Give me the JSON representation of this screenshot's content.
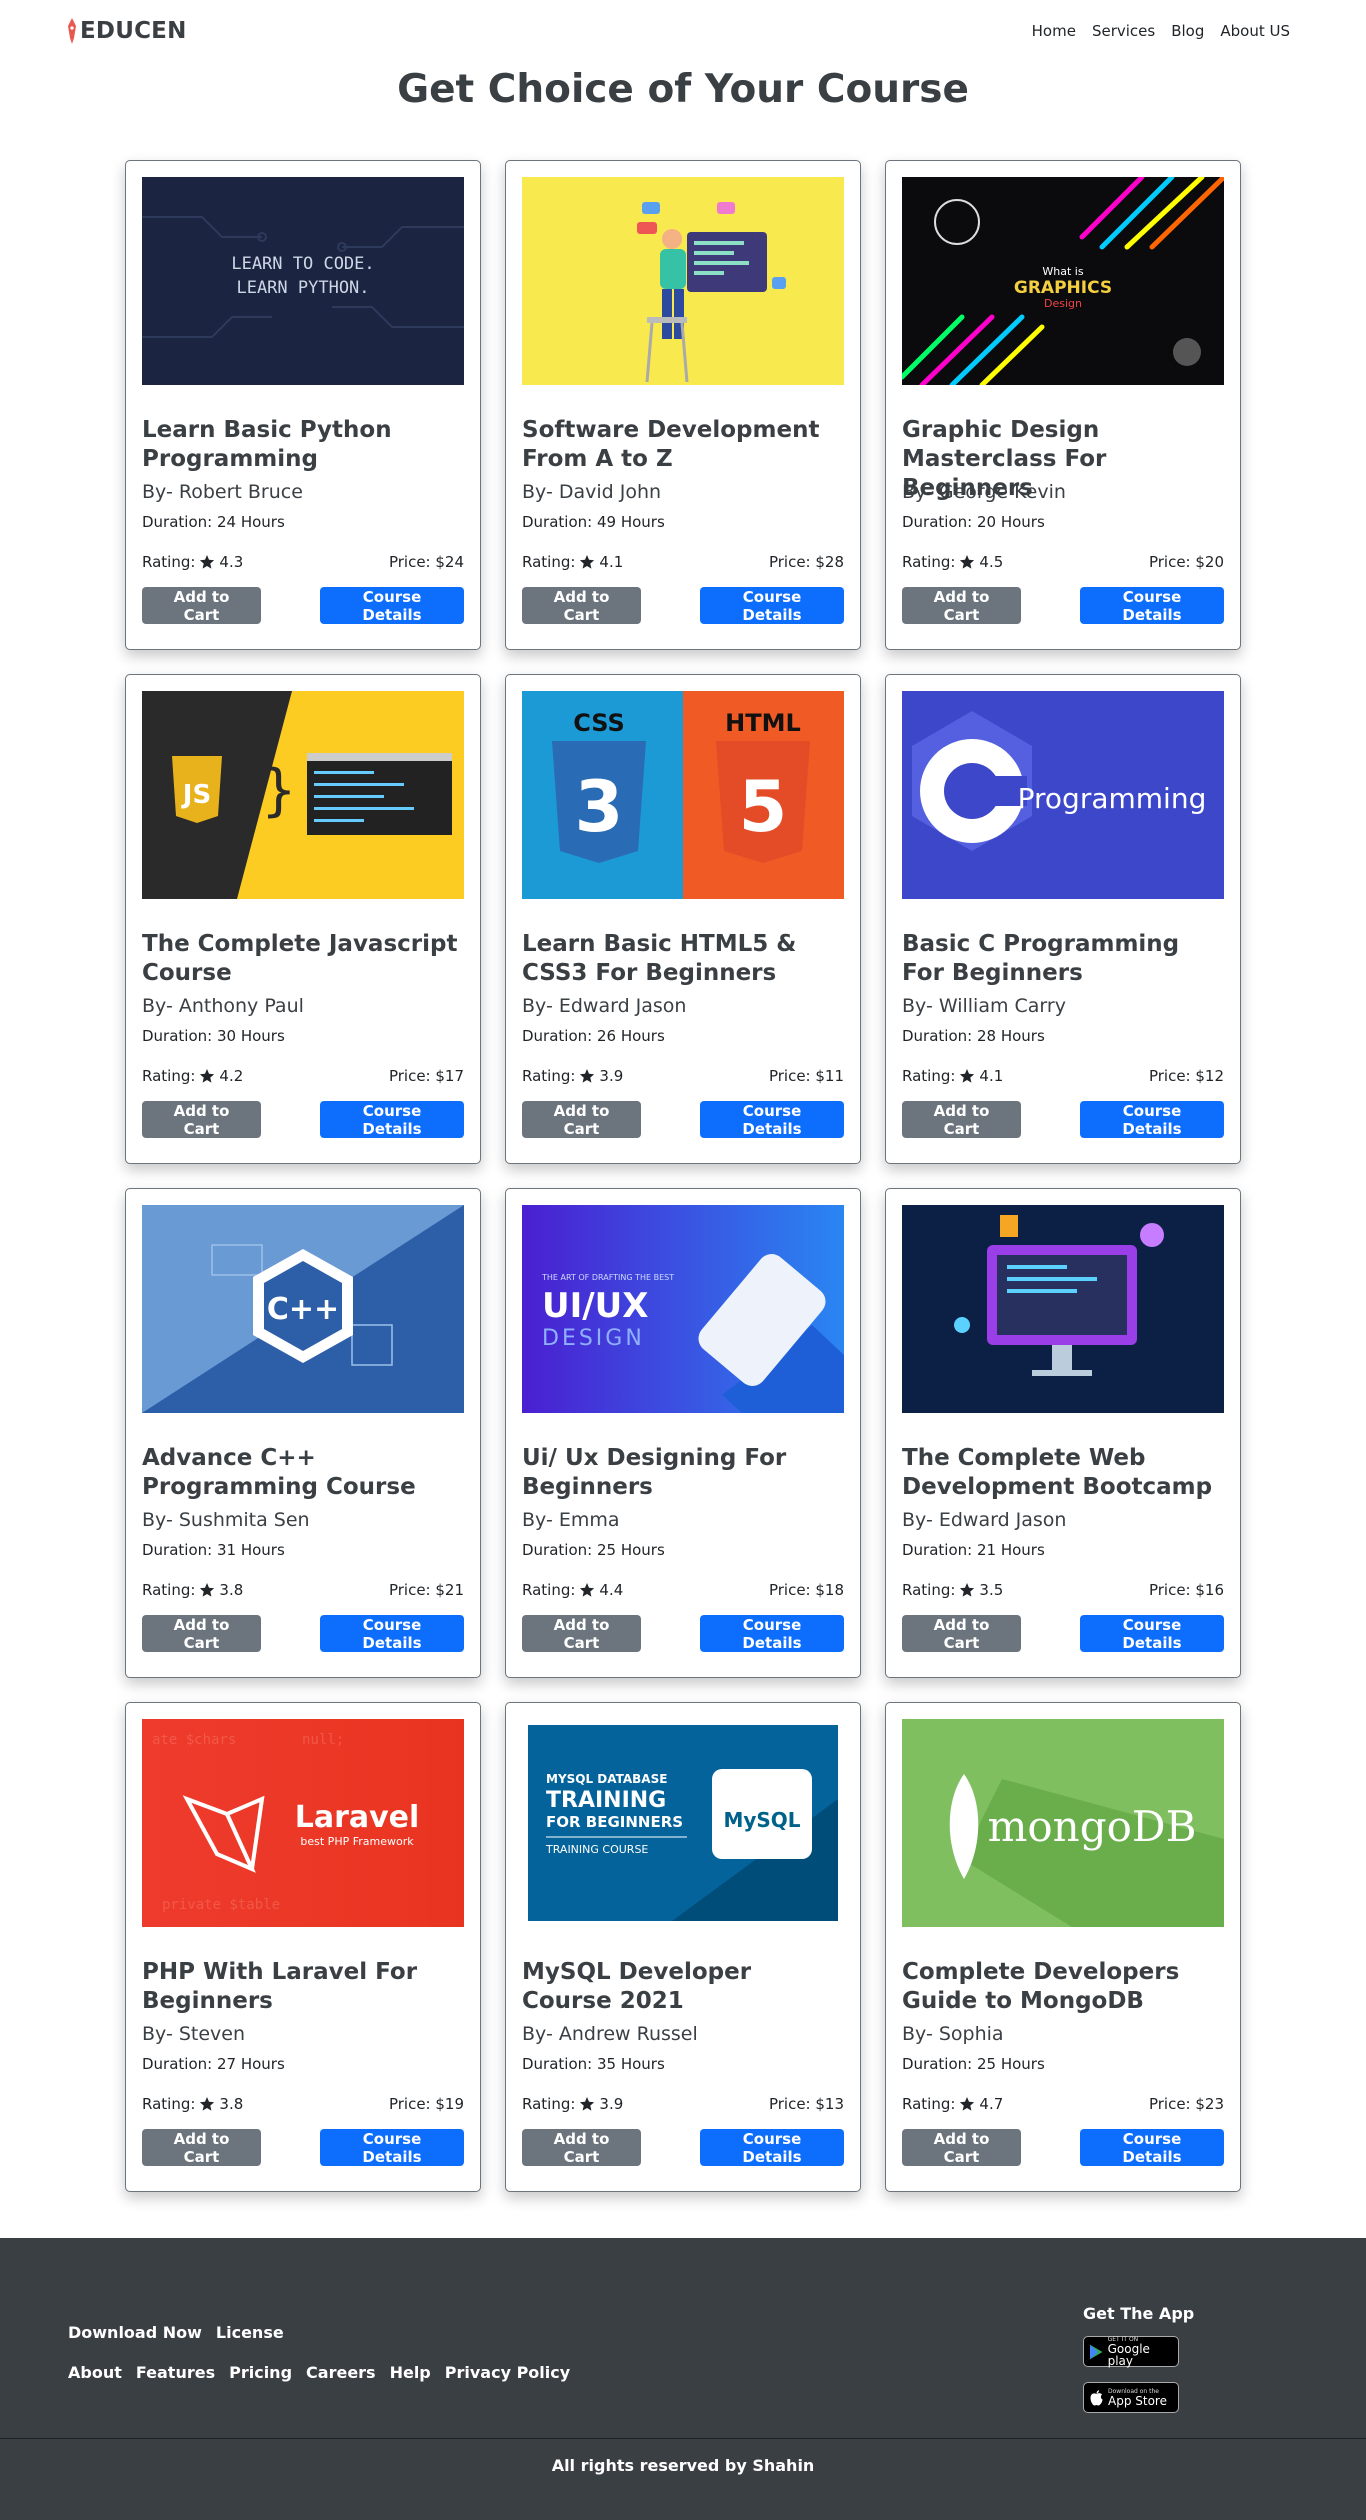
{
  "nav": {
    "brand": "EDUCEN",
    "links": [
      "Home",
      "Services",
      "Blog",
      "About US"
    ]
  },
  "page_title": "Get Choice of Your Course",
  "courses": [
    {
      "title": "Learn Basic Python Programming",
      "author": "By- Robert Bruce",
      "duration": "Duration: 24 Hours",
      "rating_label": "Rating:",
      "rating": "4.3",
      "price": "Price: $24",
      "thumb_text": "LEARN TO CODE. LEARN PYTHON."
    },
    {
      "title": "Software Development From A to Z",
      "author": "By- David John",
      "duration": "Duration: 49 Hours",
      "rating_label": "Rating:",
      "rating": "4.1",
      "price": "Price: $28",
      "thumb_text": ""
    },
    {
      "title": "Graphic Design Masterclass For Beginners",
      "author": "By- George Kevin",
      "duration": "Duration: 20 Hours",
      "rating_label": "Rating:",
      "rating": "4.5",
      "price": "Price: $20",
      "thumb_text": "What is GRAPHICS Design"
    },
    {
      "title": "The Complete Javascript Course",
      "author": "By- Anthony Paul",
      "duration": "Duration: 30 Hours",
      "rating_label": "Rating:",
      "rating": "4.2",
      "price": "Price: $17",
      "thumb_text": "JS"
    },
    {
      "title": "Learn Basic HTML5 & CSS3 For Beginners",
      "author": "By- Edward Jason",
      "duration": "Duration: 26 Hours",
      "rating_label": "Rating:",
      "rating": "3.9",
      "price": "Price: $11",
      "thumb_text": "CSS HTML"
    },
    {
      "title": "Basic C Programming For Beginners",
      "author": "By- William Carry",
      "duration": "Duration: 28 Hours",
      "rating_label": "Rating:",
      "rating": "4.1",
      "price": "Price: $12",
      "thumb_text": "Programming"
    },
    {
      "title": "Advance C++ Programming Course",
      "author": "By- Sushmita Sen",
      "duration": "Duration: 31 Hours",
      "rating_label": "Rating:",
      "rating": "3.8",
      "price": "Price: $21",
      "thumb_text": "C++"
    },
    {
      "title": "Ui/ Ux Designing For Beginners",
      "author": "By- Emma",
      "duration": "Duration: 25 Hours",
      "rating_label": "Rating:",
      "rating": "4.4",
      "price": "Price: $18",
      "thumb_text": "UI/UX DESIGN"
    },
    {
      "title": "The Complete Web Development Bootcamp",
      "author": "By- Edward Jason",
      "duration": "Duration: 21 Hours",
      "rating_label": "Rating:",
      "rating": "3.5",
      "price": "Price: $16",
      "thumb_text": ""
    },
    {
      "title": "PHP With Laravel For Beginners",
      "author": "By- Steven",
      "duration": "Duration: 27 Hours",
      "rating_label": "Rating:",
      "rating": "3.8",
      "price": "Price: $19",
      "thumb_text": "Laravel best PHP Framework"
    },
    {
      "title": "MySQL Developer Course 2021",
      "author": "By- Andrew Russel",
      "duration": "Duration: 35 Hours",
      "rating_label": "Rating:",
      "rating": "3.9",
      "price": "Price: $13",
      "thumb_text": "MYSQL DATABASE TRAINING FOR BEGINNERS TRAINING COURSE MySQL"
    },
    {
      "title": "Complete Developers Guide to MongoDB",
      "author": "By- Sophia",
      "duration": "Duration: 25 Hours",
      "rating_label": "Rating:",
      "rating": "4.7",
      "price": "Price: $23",
      "thumb_text": "mongoDB"
    }
  ],
  "buttons": {
    "add_to_cart": "Add to Cart",
    "details": "Course Details"
  },
  "footer": {
    "row1": [
      "Download Now",
      "License"
    ],
    "row2": [
      "About",
      "Features",
      "Pricing",
      "Careers",
      "Help",
      "Privacy Policy"
    ],
    "get_app": "Get The App",
    "google_small": "GET IT ON",
    "google_big": "Google play",
    "apple_small": "Download on the",
    "apple_big": "App Store",
    "copyright": "All rights reserved by Shahin"
  },
  "colors": {
    "primary": "#0d6efd",
    "secondary": "#6c757d",
    "dark": "#3a3f44"
  }
}
